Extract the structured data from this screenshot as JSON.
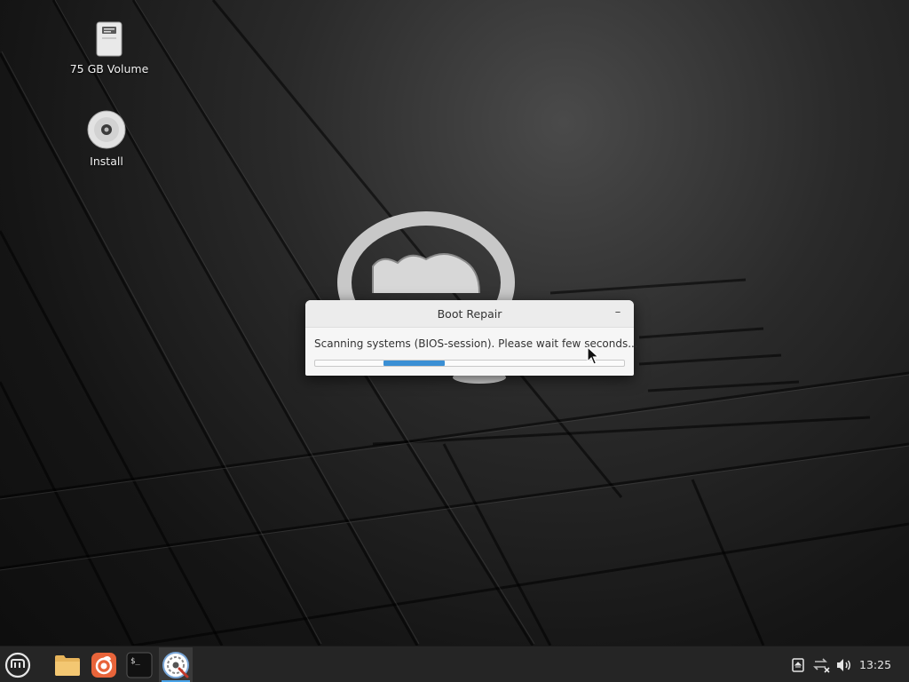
{
  "desktop": {
    "icons": [
      {
        "label": "75 GB Volume",
        "icon": "drive-icon"
      },
      {
        "label": "Install",
        "icon": "disc-icon"
      }
    ]
  },
  "dialog": {
    "title": "Boot Repair",
    "minimize_label": "–",
    "message": "Scanning systems (BIOS-session). Please wait few seconds...",
    "progress": {
      "start_fraction": 0.22,
      "end_fraction": 0.42,
      "indeterminate": true,
      "color": "#3a8fd4"
    }
  },
  "taskbar": {
    "launchers": [
      {
        "name": "menu",
        "icon": "mint-logo-icon"
      },
      {
        "name": "files",
        "icon": "folder-icon"
      },
      {
        "name": "firefox",
        "icon": "firefox-icon"
      },
      {
        "name": "terminal",
        "icon": "terminal-icon"
      },
      {
        "name": "boot-repair",
        "icon": "boot-repair-icon",
        "active": true
      }
    ],
    "tray": [
      "removable-drive-icon",
      "network-disconnected-icon",
      "volume-icon"
    ],
    "clock": "13:25"
  },
  "colors": {
    "accent": "#4aa3e8",
    "taskbar_bg": "#252525",
    "dialog_bg": "#f6f6f6"
  }
}
